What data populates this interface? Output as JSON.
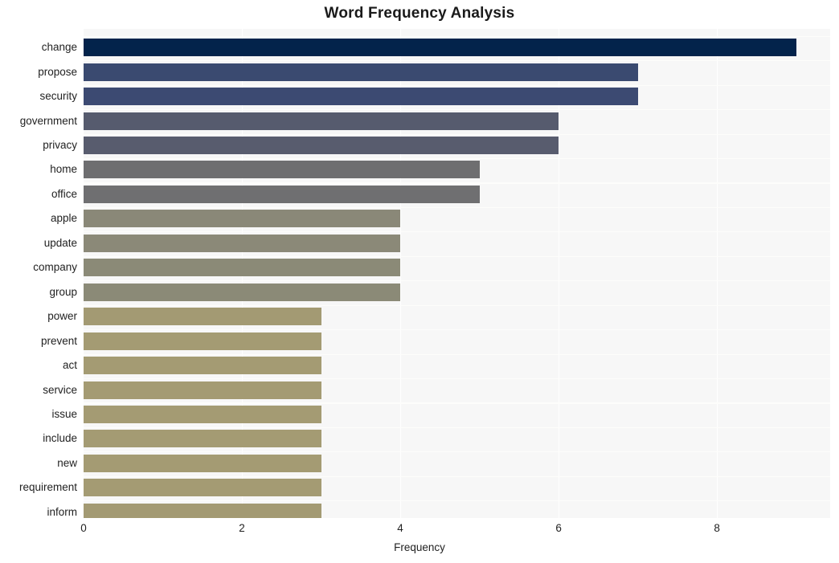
{
  "chart_data": {
    "type": "bar",
    "orientation": "horizontal",
    "title": "Word Frequency Analysis",
    "xlabel": "Frequency",
    "ylabel": "",
    "categories": [
      "change",
      "propose",
      "security",
      "government",
      "privacy",
      "home",
      "office",
      "apple",
      "update",
      "company",
      "group",
      "power",
      "prevent",
      "act",
      "service",
      "issue",
      "include",
      "new",
      "requirement",
      "inform"
    ],
    "values": [
      9,
      7,
      7,
      6,
      6,
      5,
      5,
      4,
      4,
      4,
      4,
      3,
      3,
      3,
      3,
      3,
      3,
      3,
      3,
      3
    ],
    "bar_colors": [
      "#03234b",
      "#3a4a70",
      "#3c4a72",
      "#565b6e",
      "#585c6e",
      "#6e6e70",
      "#6f6f71",
      "#8a8878",
      "#8b8978",
      "#8b8a77",
      "#8b8a77",
      "#a39a73",
      "#a49b73",
      "#a49b73",
      "#a49b73",
      "#a49b73",
      "#a49b73",
      "#a49b73",
      "#a49b73",
      "#a39a73"
    ],
    "xticks": [
      0,
      2,
      4,
      6,
      8
    ],
    "xlim": [
      0,
      9.43
    ],
    "grid": true,
    "grid_axis": "x",
    "legend": "none",
    "plot_background": "#f7f7f7",
    "figure_background": "#ffffff"
  }
}
